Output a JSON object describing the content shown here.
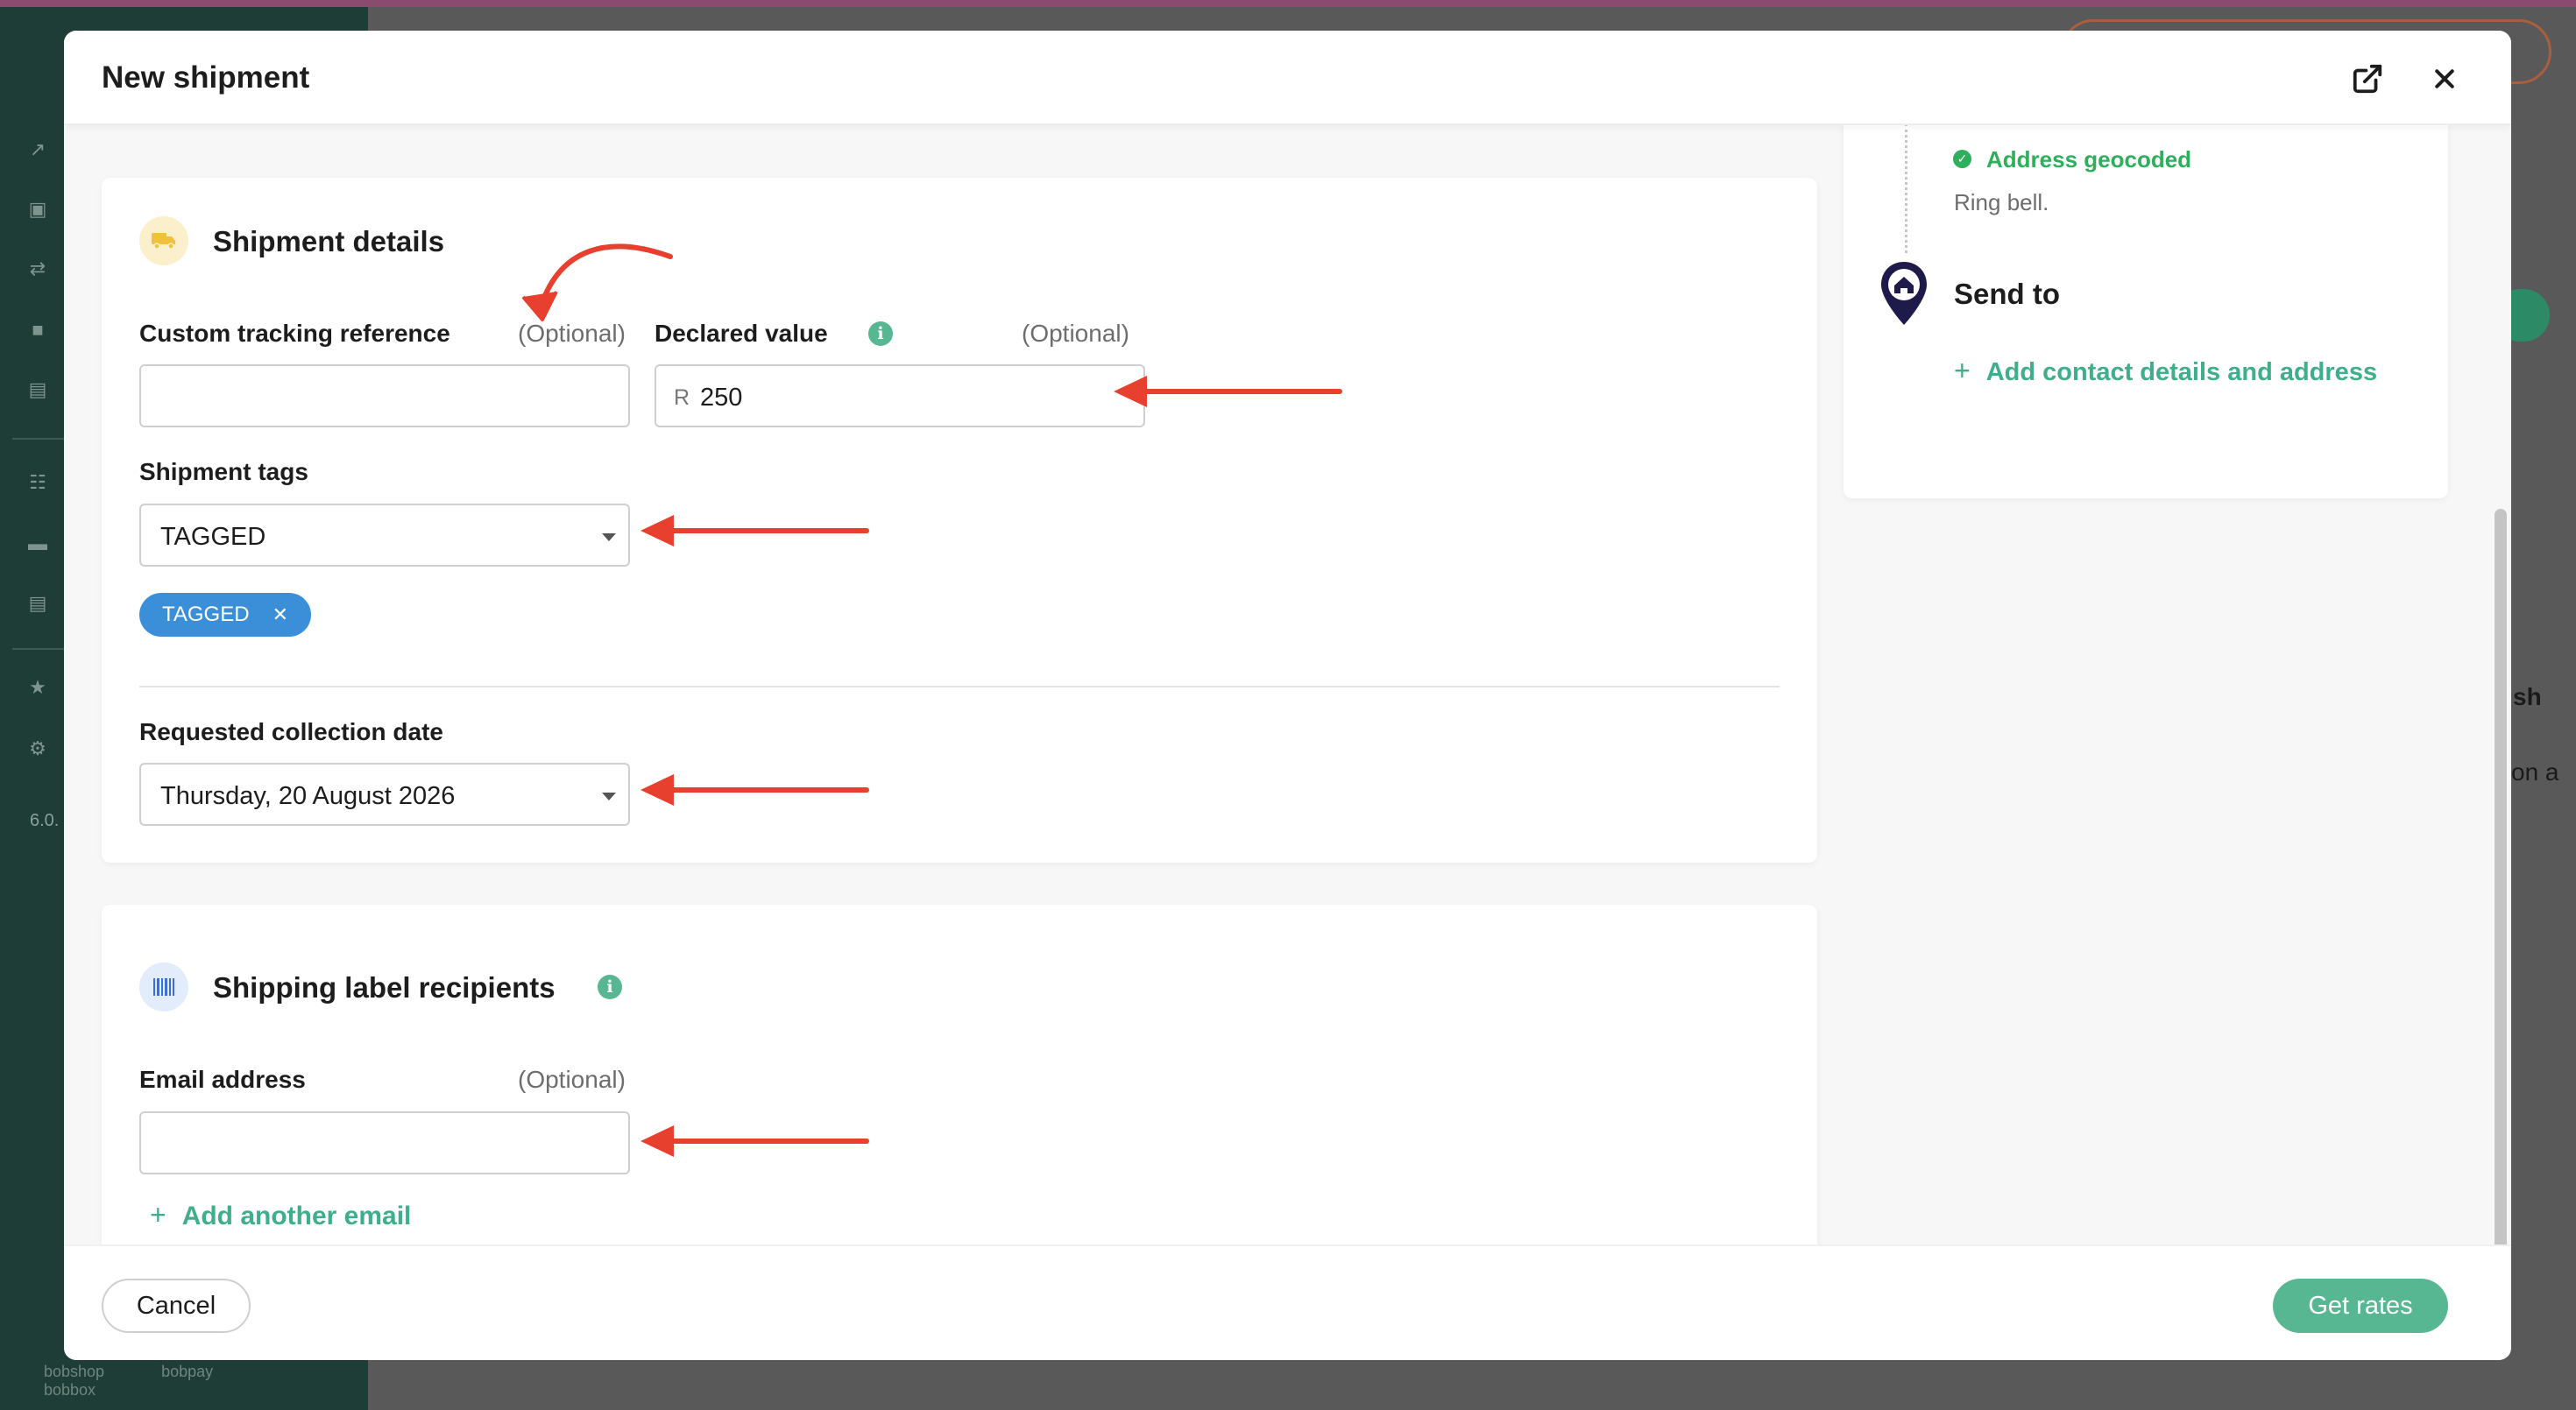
{
  "modal": {
    "title": "New shipment",
    "open_external_icon": "external-link-icon",
    "close_icon": "close-icon"
  },
  "shipment_details": {
    "title": "Shipment details",
    "icon": "truck-icon",
    "custom_tracking": {
      "label": "Custom tracking reference",
      "optional": "(Optional)",
      "value": ""
    },
    "declared_value": {
      "label": "Declared value",
      "optional": "(Optional)",
      "currency": "R",
      "value": "250"
    },
    "tags": {
      "label": "Shipment tags",
      "selected": "TAGGED",
      "chips": [
        "TAGGED"
      ]
    },
    "collection_date": {
      "label": "Requested collection date",
      "value": "Thursday, 20 August 2026"
    }
  },
  "label_recipients": {
    "title": "Shipping label recipients",
    "icon": "barcode-icon",
    "email": {
      "label": "Email address",
      "optional": "(Optional)",
      "value": ""
    },
    "add_email": "Add another email"
  },
  "route": {
    "geocoded": "Address geocoded",
    "note": "Ring bell.",
    "send_to": "Send to",
    "add_contact": "Add contact details and address"
  },
  "footer": {
    "cancel": "Cancel",
    "get_rates": "Get rates"
  },
  "background": {
    "version": "6.0.",
    "brands": [
      "bobshop",
      "bobpay",
      "bobbox"
    ],
    "cut_text_1": "sh",
    "cut_text_2": "on a"
  },
  "colors": {
    "accent": "#57b793",
    "tag": "#3a8fd8",
    "annotation": "#e8402f",
    "pin": "#1e1a4a"
  }
}
